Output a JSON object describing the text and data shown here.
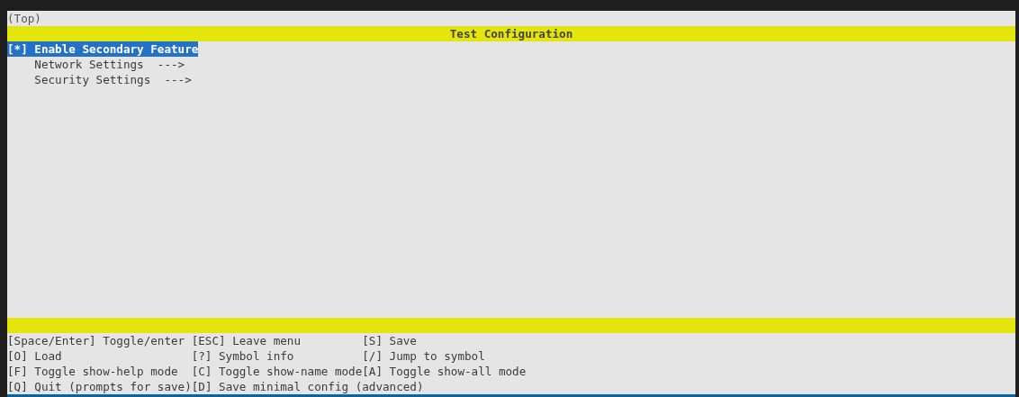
{
  "breadcrumb": "(Top)",
  "title": "Test Configuration",
  "items": [
    {
      "kind": "bool",
      "marker": "[*]",
      "label": "Enable Secondary Feature",
      "selected": true
    },
    {
      "kind": "menu",
      "label": "Network Settings",
      "arrow": "--->",
      "selected": false
    },
    {
      "kind": "menu",
      "label": "Security Settings",
      "arrow": "--->",
      "selected": false
    }
  ],
  "help": [
    [
      "[Space/Enter] Toggle/enter",
      "[ESC] Leave menu",
      "[S] Save"
    ],
    [
      "[O] Load",
      "[?] Symbol info",
      "[/] Jump to symbol"
    ],
    [
      "[F] Toggle show-help mode",
      "[C] Toggle show-name mode",
      "[A] Toggle show-all mode"
    ],
    [
      "[Q] Quit (prompts for save)",
      "[D] Save minimal config (advanced)"
    ]
  ]
}
